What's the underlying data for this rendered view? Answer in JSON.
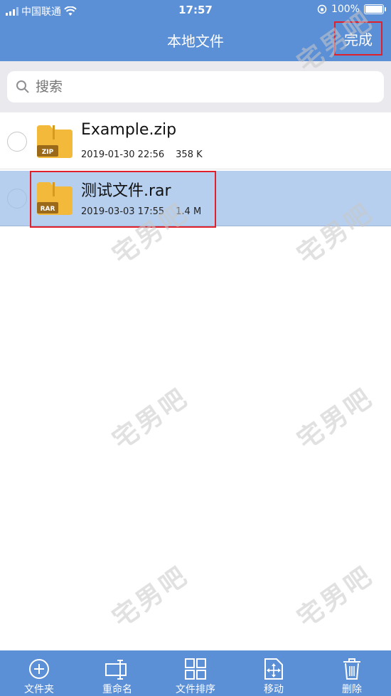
{
  "status_bar": {
    "carrier": "中国联通",
    "time": "17:57",
    "battery": "100%",
    "battery_level": 1.0
  },
  "nav": {
    "title": "本地文件",
    "done_label": "完成"
  },
  "search": {
    "placeholder": "搜索"
  },
  "files": [
    {
      "name": "Example.zip",
      "date": "2019-01-30 22:56",
      "size": "358 K",
      "badge": "ZIP",
      "selected": false
    },
    {
      "name": "测试文件.rar",
      "date": "2019-03-03 17:55",
      "size": "1.4 M",
      "badge": "RAR",
      "selected": true
    }
  ],
  "toolbar": {
    "items": [
      {
        "label": "文件夹",
        "icon": "add-circle-icon"
      },
      {
        "label": "重命名",
        "icon": "rename-icon"
      },
      {
        "label": "文件排序",
        "icon": "grid-icon"
      },
      {
        "label": "移动",
        "icon": "move-icon"
      },
      {
        "label": "删除",
        "icon": "trash-icon"
      }
    ]
  },
  "watermark": "宅男吧",
  "colors": {
    "header": "#5b8fd6",
    "selected_row": "#b7cfee",
    "highlight": "#e0202a",
    "folder": "#f2b93b"
  }
}
